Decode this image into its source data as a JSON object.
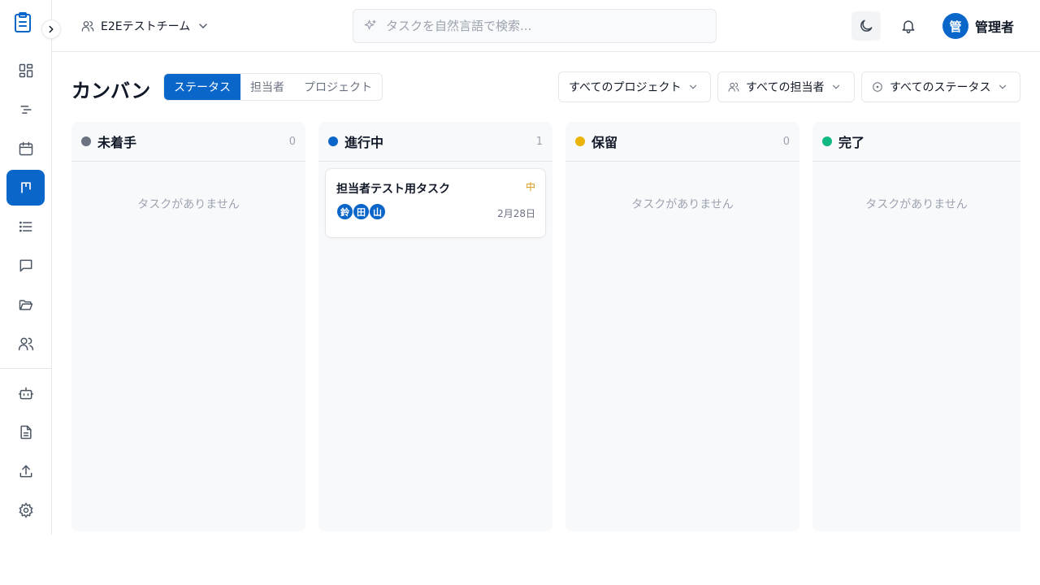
{
  "header": {
    "team_name": "E2Eテストチーム",
    "search_placeholder": "タスクを自然言語で検索...",
    "user_initial": "管",
    "user_name": "管理者"
  },
  "toolbar": {
    "title": "カンバン",
    "view_tabs": [
      "ステータス",
      "担当者",
      "プロジェクト"
    ],
    "active_view_tab": "ステータス",
    "filters": {
      "project": "すべてのプロジェクト",
      "assignee": "すべての担当者",
      "status": "すべてのステータス"
    }
  },
  "sidebar": {
    "nav": [
      "dashboard-icon",
      "gantt-icon",
      "calendar-icon",
      "kanban-icon",
      "list-icon",
      "chat-icon",
      "folder-icon",
      "users-icon",
      "bot-icon",
      "document-icon",
      "upload-icon",
      "gear-icon"
    ],
    "active": "kanban-icon"
  },
  "columns": [
    {
      "title": "未着手",
      "count": "0",
      "color": "#6b7280",
      "empty_text": "タスクがありません"
    },
    {
      "title": "進行中",
      "count": "1",
      "color": "#0a66c9",
      "empty_text": ""
    },
    {
      "title": "保留",
      "count": "0",
      "color": "#eab308",
      "empty_text": "タスクがありません"
    },
    {
      "title": "完了",
      "count": "",
      "color": "#10b981",
      "empty_text": "タスクがありません"
    }
  ],
  "card": {
    "title": "担当者テスト用タスク",
    "priority": "中",
    "assignees": [
      "鈴",
      "田",
      "山"
    ],
    "due": "2月28日"
  },
  "colors": {
    "accent": "#0a66c9",
    "priority_medium": "#d89b1d"
  }
}
